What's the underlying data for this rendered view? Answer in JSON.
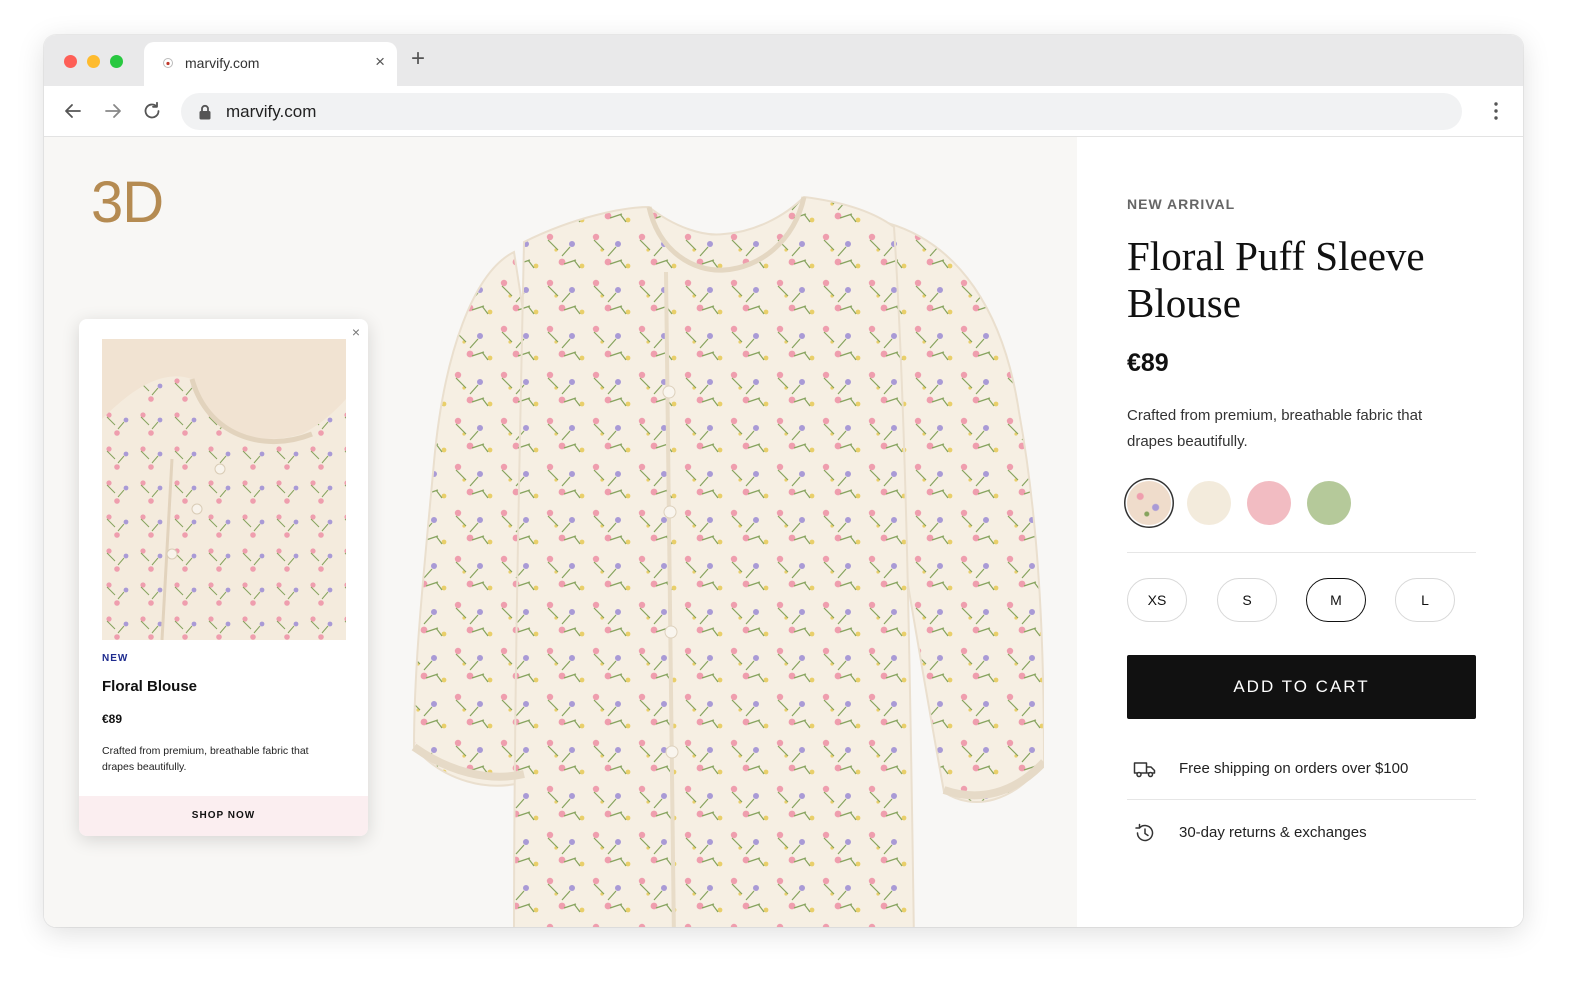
{
  "browser": {
    "tab_title": "marvify.com",
    "tab_close": "×",
    "new_tab": "+",
    "url": "marvify.com"
  },
  "stage": {
    "badge": "3D"
  },
  "card": {
    "close": "×",
    "badge": "NEW",
    "title": "Floral Blouse",
    "price": "€89",
    "description": "Crafted from premium, breathable fabric that drapes beautifully.",
    "cta": "SHOP NOW"
  },
  "product": {
    "eyebrow": "NEW ARRIVAL",
    "title": "Floral Puff Sleeve Blouse",
    "price": "€89",
    "description": "Crafted from premium, breathable fabric that drapes beautifully.",
    "swatches": [
      {
        "name": "floral",
        "color": "#efdccb",
        "selected": true
      },
      {
        "name": "cream",
        "color": "#f3ebdc",
        "selected": false
      },
      {
        "name": "pink",
        "color": "#f2bcc2",
        "selected": false
      },
      {
        "name": "sage",
        "color": "#b5c99a",
        "selected": false
      }
    ],
    "sizes": [
      {
        "label": "XS",
        "selected": false
      },
      {
        "label": "S",
        "selected": false
      },
      {
        "label": "M",
        "selected": true
      },
      {
        "label": "L",
        "selected": false
      }
    ],
    "add_to_cart": "ADD TO CART",
    "perks": [
      {
        "icon": "truck-icon",
        "text": "Free shipping on orders over $100"
      },
      {
        "icon": "history-icon",
        "text": "30-day returns & exchanges"
      }
    ]
  },
  "colors": {
    "accent_3d": "#b58b52",
    "cta_bg": "#111111",
    "card_cta_bg": "#fbeef0",
    "badge_blue": "#1f2c8f"
  }
}
